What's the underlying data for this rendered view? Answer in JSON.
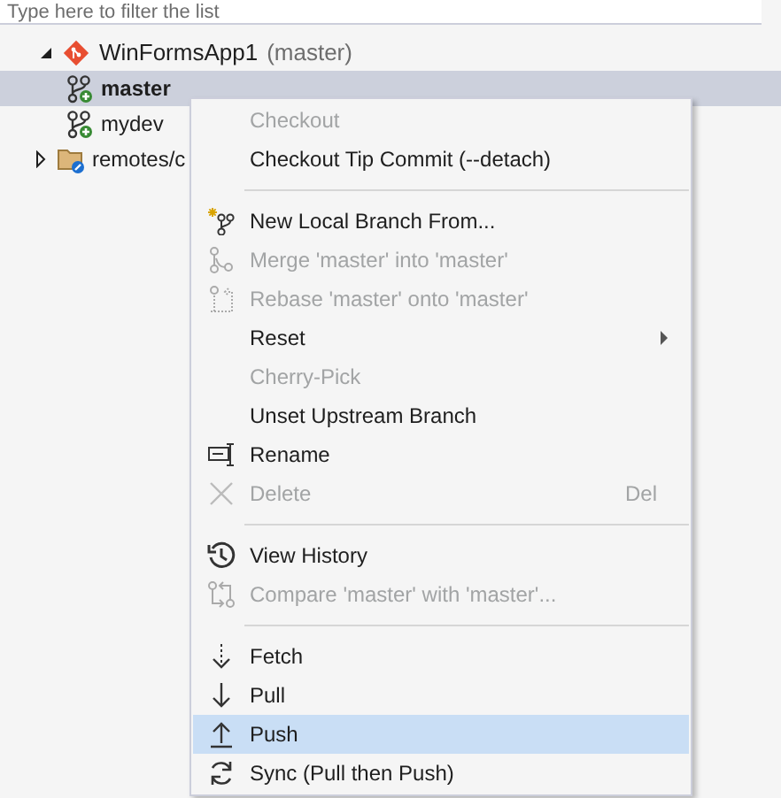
{
  "filter": {
    "placeholder": "Type here to filter the list"
  },
  "tree": [
    {
      "label": "WinFormsApp1",
      "detail": "(master)",
      "expanded": true,
      "children": [
        {
          "label": "master",
          "selected": true,
          "current": true
        },
        {
          "label": "mydev",
          "selected": false,
          "current": false
        },
        {
          "label": "remotes/c",
          "selected": false,
          "current": false,
          "expanded": false,
          "kind": "folder"
        }
      ]
    }
  ],
  "context_menu": [
    {
      "kind": "item",
      "label": "Checkout",
      "disabled": true,
      "selected": false
    },
    {
      "kind": "item",
      "label": "Checkout Tip Commit (--detach)",
      "disabled": false,
      "selected": false
    },
    {
      "kind": "separator"
    },
    {
      "kind": "item",
      "label": "New Local Branch From...",
      "disabled": false,
      "selected": false
    },
    {
      "kind": "item",
      "label": "Merge 'master' into 'master'",
      "disabled": true,
      "selected": false
    },
    {
      "kind": "item",
      "label": "Rebase 'master' onto 'master'",
      "disabled": true,
      "selected": false
    },
    {
      "kind": "item",
      "label": "Reset",
      "disabled": false,
      "selected": false,
      "submenu": true
    },
    {
      "kind": "item",
      "label": "Cherry-Pick",
      "disabled": true,
      "selected": false
    },
    {
      "kind": "item",
      "label": "Unset Upstream Branch",
      "disabled": false,
      "selected": false
    },
    {
      "kind": "item",
      "label": "Rename",
      "disabled": false,
      "selected": false
    },
    {
      "kind": "item",
      "label": "Delete",
      "disabled": true,
      "selected": false,
      "shortcut": "Del"
    },
    {
      "kind": "separator"
    },
    {
      "kind": "item",
      "label": "View History",
      "disabled": false,
      "selected": false
    },
    {
      "kind": "item",
      "label": "Compare 'master' with 'master'...",
      "disabled": true,
      "selected": false
    },
    {
      "kind": "separator"
    },
    {
      "kind": "item",
      "label": "Fetch",
      "disabled": false,
      "selected": false
    },
    {
      "kind": "item",
      "label": "Pull",
      "disabled": false,
      "selected": false
    },
    {
      "kind": "item",
      "label": "Push",
      "disabled": false,
      "selected": true
    },
    {
      "kind": "item",
      "label": "Sync (Pull then Push)",
      "disabled": false,
      "selected": false
    }
  ]
}
